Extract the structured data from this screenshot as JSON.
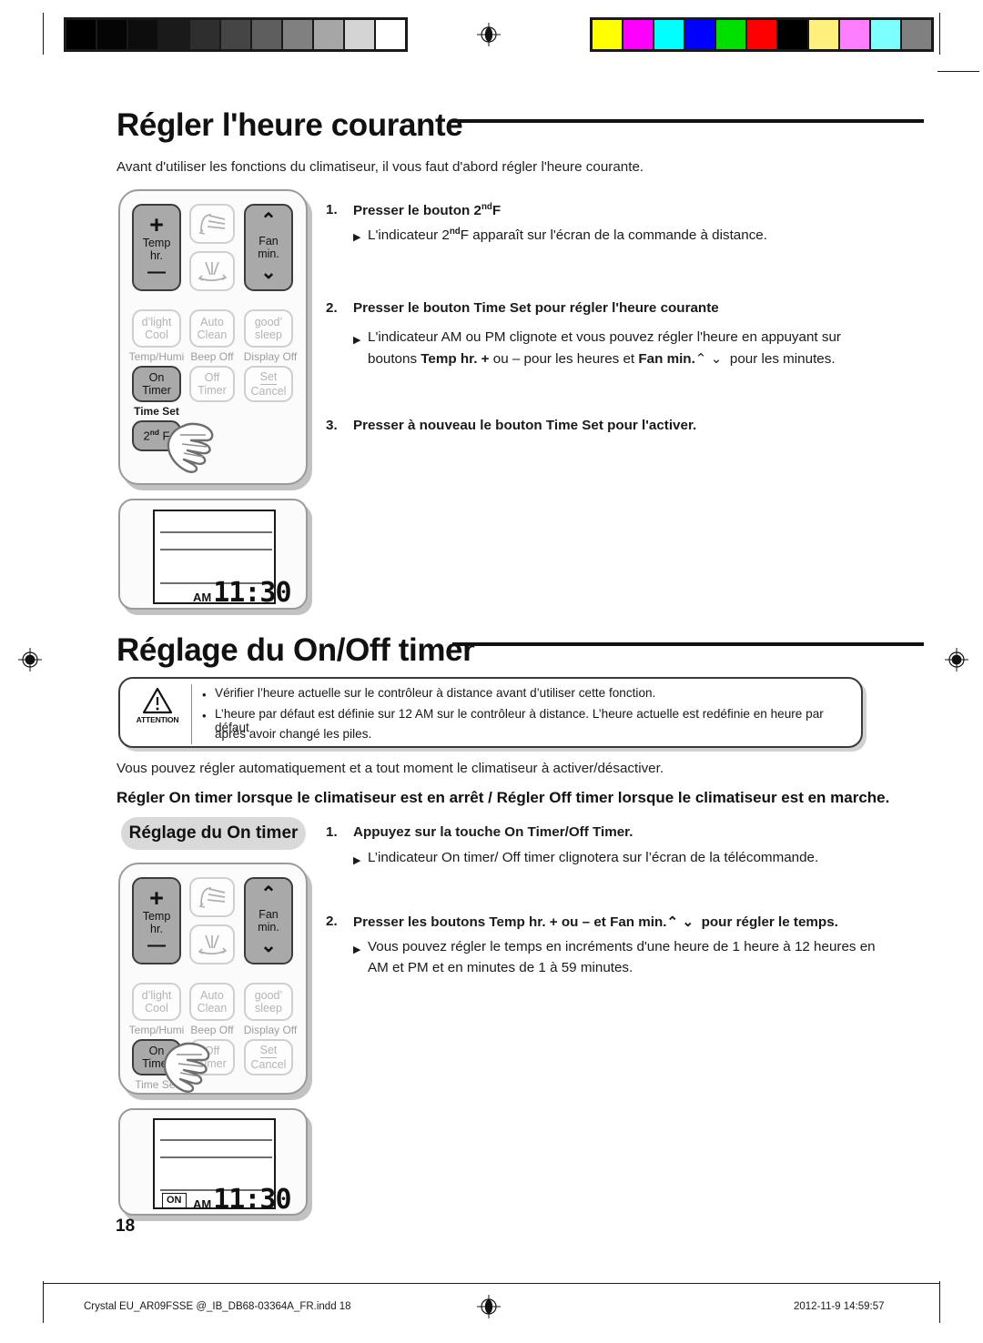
{
  "document": {
    "page_number": "18",
    "footer_file": "Crystal  EU_AR09FSSE @_IB_DB68-03364A_FR.indd   18",
    "footer_timestamp": "2012-11-9   14:59:57"
  },
  "calibration": {
    "grayscale": [
      "#000000",
      "#050505",
      "#0d0d0d",
      "#1a1a1a",
      "#2e2e2e",
      "#454545",
      "#5e5e5e",
      "#808080",
      "#a6a6a6",
      "#d4d4d4",
      "#ffffff"
    ],
    "colors": [
      "#ffff00",
      "#ff00ff",
      "#00ffff",
      "#0000ff",
      "#00e000",
      "#ff0000",
      "#000000",
      "#ffef7d",
      "#ff7dff",
      "#7dffff",
      "#808080"
    ]
  },
  "section1": {
    "title": "Régler l'heure courante",
    "intro": "Avant d'utiliser les fonctions du climatiseur, il vous faut d'abord régler l'heure courante.",
    "steps": [
      {
        "num": "1.",
        "text_html": "Presser le bouton 2<sup>nd</sup>F",
        "subs": [
          {
            "marker": "▶",
            "lines_html": [
              "L'indicateur 2<sup>nd</sup>F apparaît sur l'écran de la commande à distance."
            ]
          }
        ]
      },
      {
        "num": "2.",
        "text_html": "Presser le bouton <span class=\"b\">Time Set</span> pour régler l'heure courante",
        "subs": [
          {
            "marker": "▶",
            "lines_html": [
              "L'indicateur AM ou PM clignote et vous pouvez régler l'heure en appuyant sur",
              "boutons <span class=\"b\">Temp hr. +</span> ou &ndash; pour les heures et <span class=\"b\">Fan min.</span>&#8963;&nbsp;&#8964;&nbsp;&nbsp;pour les minutes."
            ]
          }
        ]
      },
      {
        "num": "3.",
        "text_html": "Presser à nouveau le bouton <span class=\"b\">Time Set</span> pour l'activer.",
        "subs": []
      }
    ]
  },
  "section2": {
    "title": "Réglage du On/Off timer",
    "attention": {
      "label": "ATTENTION",
      "icon": "warning-triangle-icon",
      "items": [
        [
          "Vérifier l’heure actuelle sur le contrôleur à distance avant d’utiliser cette fonction."
        ],
        [
          "L’heure par défaut est définie sur 12 AM sur le contrôleur à distance. L’heure actuelle est redéfinie en heure par défaut",
          "après avoir changé les piles."
        ]
      ]
    },
    "intro": "Vous pouvez régler automatiquement et a tout moment le climatiseur à activer/désactiver.",
    "bold_line": "Régler On timer  lorsque le climatiseur est en arrêt / Régler Off timer lorsque le climatiseur est en marche.",
    "pill_label": "Réglage du On timer",
    "steps": [
      {
        "num": "1.",
        "text_html": "Appuyez sur la touche <span class=\"b\">On Timer/Off Timer.</span>",
        "subs": [
          {
            "marker": "▶",
            "lines_html": [
              "L’indicateur On timer/ Off timer clignotera sur l’écran de la télécommande."
            ]
          }
        ]
      },
      {
        "num": "2.",
        "text_html": "Presser les boutons <span class=\"b\">Temp hr. +</span> ou &ndash; et <span class=\"b\">Fan min.</span>&#8963;&nbsp;&#8964;&nbsp;&nbsp;pour régler le temps.",
        "subs": [
          {
            "marker": "▶",
            "lines_html": [
              "Vous pouvez régler le temps en incréments d'une heure de 1 heure à 12 heures en",
              "AM et PM et en minutes de 1 à 59 minutes."
            ]
          }
        ]
      }
    ]
  },
  "remote_top": {
    "name": "remote-control-diagram-top",
    "keys": {
      "temp_hr": {
        "plus": "+",
        "line1": "Temp",
        "line2": "hr.",
        "minus": "—"
      },
      "swing_up": {
        "icon": "airflow-up-icon"
      },
      "swing_down": {
        "icon": "airflow-down-icon"
      },
      "fan_min": {
        "up": "⌃",
        "line1": "Fan",
        "line2": "min.",
        "down": "⌄"
      },
      "dlight_cool": {
        "line1": "d’light",
        "line2": "Cool",
        "sublabel": "Temp/Humi"
      },
      "auto_clean": {
        "line1": "Auto",
        "line2": "Clean",
        "sublabel": "Beep Off"
      },
      "good_sleep": {
        "line1": "good’",
        "line2": "sleep",
        "sublabel": "Display Off"
      },
      "on_timer": {
        "line1": "On",
        "line2": "Timer",
        "sublabel": "Time Set"
      },
      "off_timer": {
        "line1": "Off",
        "line2": "Timer",
        "sublabel": ""
      },
      "set_cancel": {
        "line1": "Set",
        "line2": "Cancel",
        "sublabel": ""
      },
      "second_f": {
        "label_html": "2<sup>nd</sup> F"
      }
    },
    "pointer": "hand-pointer-icon"
  },
  "remote_bottom": {
    "name": "remote-control-diagram-bottom",
    "keys": {
      "temp_hr": {
        "plus": "+",
        "line1": "Temp",
        "line2": "hr.",
        "minus": "—"
      },
      "swing_up": {
        "icon": "airflow-up-icon"
      },
      "swing_down": {
        "icon": "airflow-down-icon"
      },
      "fan_min": {
        "up": "⌃",
        "line1": "Fan",
        "line2": "min.",
        "down": "⌄"
      },
      "dlight_cool": {
        "line1": "d’light",
        "line2": "Cool",
        "sublabel": "Temp/Humi"
      },
      "auto_clean": {
        "line1": "Auto",
        "line2": "Clean",
        "sublabel": "Beep Off"
      },
      "good_sleep": {
        "line1": "good’",
        "line2": "sleep",
        "sublabel": "Display Off"
      },
      "on_timer": {
        "line1": "On",
        "line2": "Timer",
        "sublabel": "Time Set"
      },
      "off_timer": {
        "line1": "Off",
        "line2": "Timer",
        "sublabel": ""
      },
      "set_cancel": {
        "line1": "Set",
        "line2": "Cancel",
        "sublabel": ""
      }
    },
    "pointer": "hand-pointer-icon"
  },
  "lcd_top": {
    "name": "remote-lcd-display-top",
    "ampm": "AM",
    "time": "11:30",
    "on_badge": null
  },
  "lcd_bottom": {
    "name": "remote-lcd-display-bottom",
    "ampm": "AM",
    "time": "11:30",
    "on_badge": "ON"
  }
}
